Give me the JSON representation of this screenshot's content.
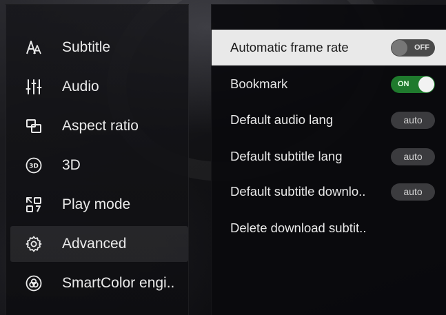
{
  "menu": {
    "items": [
      {
        "label": "Subtitle",
        "icon": "font-size-icon",
        "active": false
      },
      {
        "label": "Audio",
        "icon": "equalizer-icon",
        "active": false
      },
      {
        "label": "Aspect ratio",
        "icon": "aspect-ratio-icon",
        "active": false
      },
      {
        "label": "3D",
        "icon": "3d-icon",
        "active": false
      },
      {
        "label": "Play mode",
        "icon": "play-mode-icon",
        "active": false
      },
      {
        "label": "Advanced",
        "icon": "gear-icon",
        "active": true
      },
      {
        "label": "SmartColor engi..",
        "icon": "smartcolor-icon",
        "active": false
      }
    ]
  },
  "settings": {
    "rows": [
      {
        "label": "Automatic frame rate",
        "control": "toggle",
        "value": "OFF",
        "highlighted": true
      },
      {
        "label": "Bookmark",
        "control": "toggle",
        "value": "ON",
        "highlighted": false
      },
      {
        "label": "Default audio lang",
        "control": "pill",
        "value": "auto",
        "highlighted": false
      },
      {
        "label": "Default subtitle lang",
        "control": "pill",
        "value": "auto",
        "highlighted": false
      },
      {
        "label": "Default subtitle downlo..",
        "control": "pill",
        "value": "auto",
        "highlighted": false
      },
      {
        "label": "Delete download subtit..",
        "control": "none",
        "value": "",
        "highlighted": false
      }
    ]
  },
  "colors": {
    "toggle_on": "#1f7a2d",
    "toggle_off": "#4a4a4a",
    "highlight_row": "#e9e9e9"
  }
}
